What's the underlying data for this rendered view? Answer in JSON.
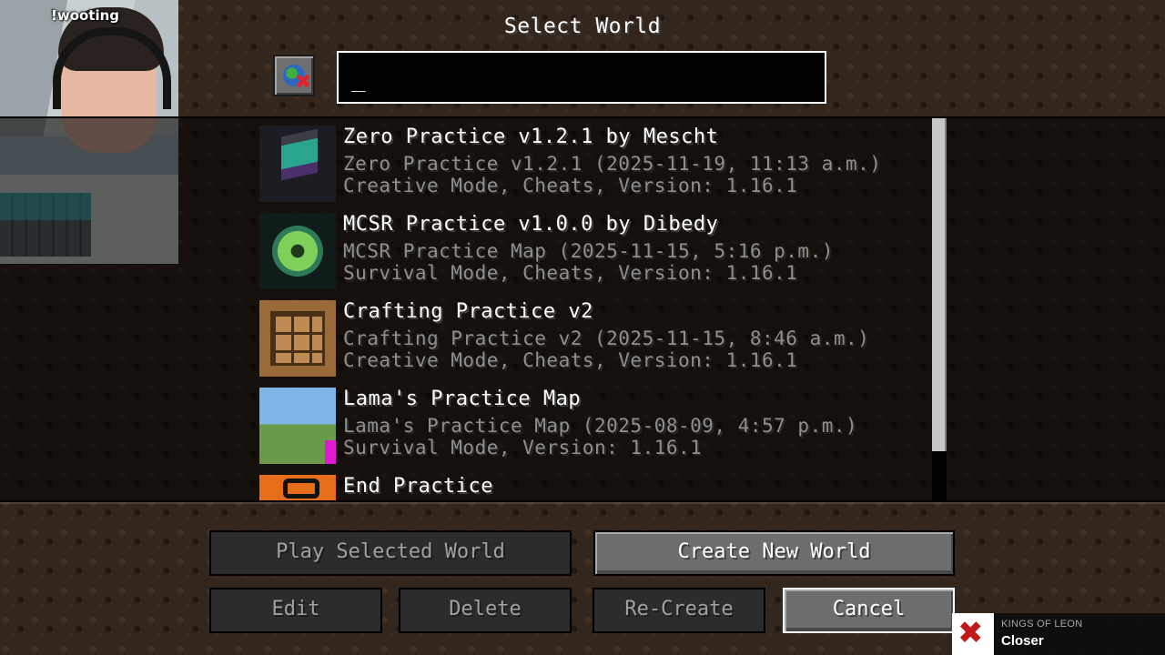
{
  "screen": {
    "title": "Select World"
  },
  "search": {
    "value": "_",
    "button_icon": "world-search-clear-icon"
  },
  "worlds": [
    {
      "name": "Zero Practice v1.2.1 by Mescht",
      "description": "Zero Practice v1.2.1 (2025-11-19, 11:13 a.m.)",
      "mode": "Creative Mode, Cheats, Version: 1.16.1",
      "icon": "zero-practice-thumbnail"
    },
    {
      "name": "MCSR Practice v1.0.0 by Dibedy",
      "description": "MCSR Practice Map (2025-11-15, 5:16 p.m.)",
      "mode": "Survival Mode, Cheats, Version: 1.16.1",
      "icon": "ender-eye-thumbnail"
    },
    {
      "name": "Crafting Practice v2",
      "description": "Crafting Practice v2 (2025-11-15, 8:46 a.m.)",
      "mode": "Creative Mode, Cheats, Version: 1.16.1",
      "icon": "crafting-table-thumbnail"
    },
    {
      "name": "Lama's Practice Map",
      "description": "Lama's Practice Map (2025-08-09, 4:57 p.m.)",
      "mode": "Survival Mode, Version: 1.16.1",
      "icon": "landscape-thumbnail"
    },
    {
      "name": "End Practice",
      "icon": "end-practice-thumbnail"
    }
  ],
  "buttons": {
    "play_selected": "Play Selected World",
    "create_new": "Create New World",
    "edit": "Edit",
    "delete": "Delete",
    "recreate": "Re-Create",
    "cancel": "Cancel"
  },
  "webcam": {
    "label": "!wooting"
  },
  "now_playing": {
    "artist": "KINGS OF LEON",
    "track": "Closer"
  }
}
